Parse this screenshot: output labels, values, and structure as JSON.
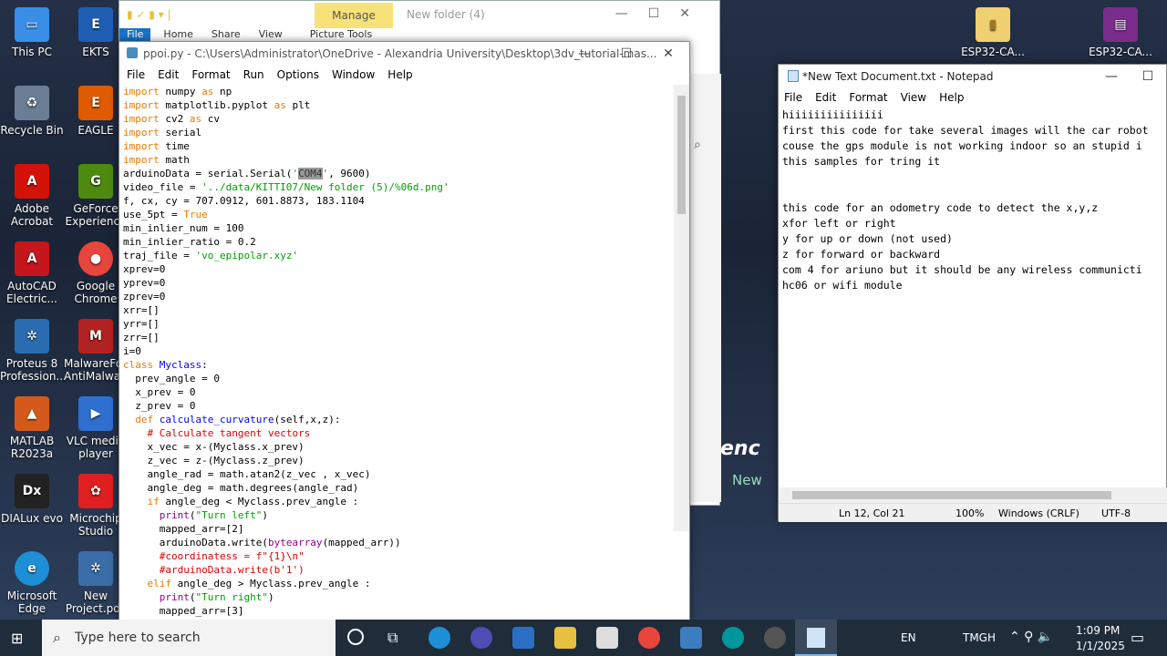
{
  "desktop": {
    "icons": [
      "This PC",
      "EKTS",
      "Recycle Bin",
      "EAGLE",
      "Adobe Acrobat",
      "GeForce Experience",
      "AutoCAD Electric...",
      "Google Chrome",
      "Proteus 8 Profession...",
      "MalwareFox AntiMalware",
      "MATLAB R2023a",
      "VLC media player",
      "DIALux evo",
      "Microchip Studio",
      "Microsoft Edge",
      "New Project.pds",
      "ESP32-CA...",
      "ESP32-CA..."
    ]
  },
  "explorer": {
    "manage": "Manage",
    "title": "New folder (4)",
    "tabs": [
      "File",
      "Home",
      "Share",
      "View",
      "Picture Tools"
    ]
  },
  "idle": {
    "title": "ppoi.py - C:\\Users\\Administrator\\OneDrive - Alexandria University\\Desktop\\3dv_tutorial-mas...",
    "menu": [
      "File",
      "Edit",
      "Format",
      "Run",
      "Options",
      "Window",
      "Help"
    ]
  },
  "notepad": {
    "title": "*New Text Document.txt - Notepad",
    "menu": [
      "File",
      "Edit",
      "Format",
      "View",
      "Help"
    ],
    "lines": [
      "hiiiiiiiiiiiiiii",
      "first this code for take several images will the car robot",
      "couse the gps module is not working indoor so an stupid i",
      "this samples for tring it",
      "",
      "",
      "this code for an odometry code to detect the x,y,z",
      "xfor left or right",
      "y for up or down (not used)",
      "z for forward or backward",
      "com 4 for ariuno but it should be any wireless communicti",
      "hc06 or wifi module "
    ],
    "status": {
      "pos": "Ln 12, Col 21",
      "zoom": "100%",
      "eol": "Windows (CRLF)",
      "enc": "UTF-8"
    }
  },
  "taskbar": {
    "search": "Type here to search",
    "lang": "EN",
    "tray_user": "TMGH",
    "time": "1:09 PM",
    "date": "1/1/2025"
  },
  "colors": {
    "keyword": "#f07800",
    "string": "#00a000",
    "defname": "#0000ff",
    "comment": "#dd0000",
    "builtin": "#900090"
  }
}
